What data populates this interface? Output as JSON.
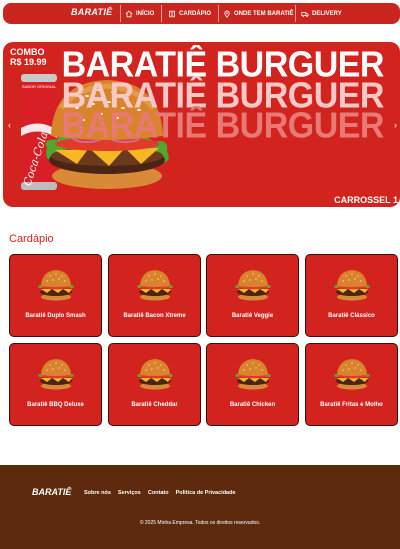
{
  "brand": "BARATIÊ",
  "nav": [
    {
      "label": "INÍCIO",
      "icon": "home-icon"
    },
    {
      "label": "CARDÁPIO",
      "icon": "menu-book-icon"
    },
    {
      "label": "ONDE TEM BARATIÊ",
      "icon": "map-pin-icon"
    },
    {
      "label": "DELIVERY",
      "icon": "delivery-icon"
    }
  ],
  "hero": {
    "combo": "COMBO",
    "price": "R$ 19.99",
    "title": "BARATIÊ BURGUER",
    "label": "CARROSSEL 1",
    "can_text": "SABOR ORIGINAL",
    "can_brand": "Coca-Cola",
    "prev": "‹",
    "next": "›"
  },
  "section": {
    "title": "Cardápio"
  },
  "products": [
    "Baratiê Duplo Smash",
    "Baratiê Bacon Xtreme",
    "Baratiê Veggie",
    "Baratiê Clássico",
    "Baratiê BBQ Deluxe",
    "Baratiê Cheddar",
    "Baratiê Chicken",
    "Baratiê Fritas e Molho"
  ],
  "footer": {
    "brand": "BARATIÊ",
    "links": [
      "Sobre nós",
      "Serviços",
      "Contato",
      "Política de Privacidade"
    ],
    "copyright": "© 2025 Minha Empresa. Todos os direitos reservados."
  },
  "colors": {
    "primary": "#c8261f",
    "footer": "#5d2a0d"
  }
}
